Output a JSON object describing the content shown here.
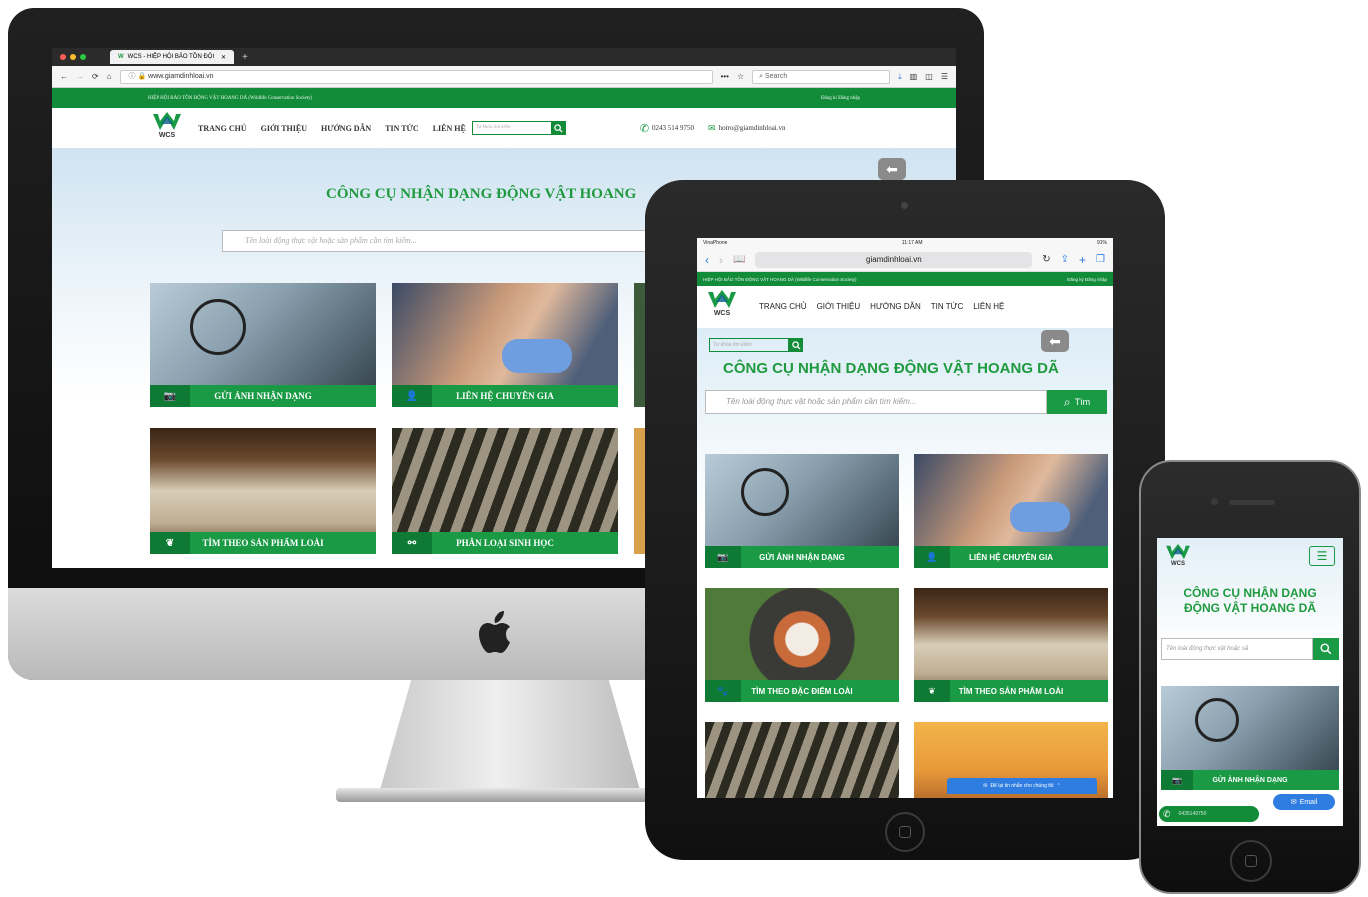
{
  "desktop": {
    "browser": {
      "tab_title": "WCS - HIỆP HỘI BẢO TỒN ĐỘI",
      "url": "www.giamdinhloai.vn",
      "search_placeholder": "Search"
    },
    "topbar": {
      "left": "HIỆP HỘI BẢO TỒN ĐỘNG VẬT HOANG DÃ (Wildlife Conservation Society)",
      "right": "Đăng kí  Đăng nhập"
    },
    "logo_text": "WCS",
    "nav": [
      "TRANG CHỦ",
      "GIỚI THIỆU",
      "HƯỚNG DẪN",
      "TIN TỨC",
      "LIÊN HỆ"
    ],
    "nav_search_placeholder": "Từ khóa tìm kiếm",
    "phone": "0243 514 9750",
    "email": "hotro@giamdinhloai.vn",
    "hero_title": "CÔNG CỤ NHẬN DẠNG ĐỘNG VẬT HOANG",
    "search_placeholder": "Tên loài động thực vật hoặc sản phẩm cần tìm kiếm...",
    "tiles": [
      "GỬI ẢNH NHẬN DẠNG",
      "LIÊN HỆ CHUYÊN GIA",
      "TÌM THEO SẢN PHẨM LOÀI",
      "PHÂN LOẠI SINH HỌC"
    ]
  },
  "tablet": {
    "status": {
      "carrier": "VinaPhone",
      "time": "11:17 AM",
      "battery": "91%"
    },
    "url": "giamdinhloai.vn",
    "topbar": {
      "left": "HIỆP HỘI BẢO TỒN ĐỘNG VẬT HOANG DÃ (Wildlife Conservation Society)",
      "right": "Đăng ký  Đăng nhập"
    },
    "logo_text": "WCS",
    "nav": [
      "TRANG CHỦ",
      "GIỚI THIỆU",
      "HƯỚNG DẪN",
      "TIN TỨC",
      "LIÊN HỆ"
    ],
    "nav_search_placeholder": "Từ khóa tìm kiếm",
    "hero_title": "CÔNG CỤ NHẬN DẠNG ĐỘNG VẬT HOANG DÃ",
    "search_placeholder": "Tên loài động thực vật hoặc sản phẩm cần tìm kiếm...",
    "search_button": "Tìm",
    "tiles": [
      "GỬI ẢNH NHẬN DẠNG",
      "LIÊN HỆ CHUYÊN GIA",
      "TÌM THEO ĐẶC ĐIỂM LOÀI",
      "TÌM THEO SẢN PHẨM LOÀI"
    ],
    "chat_text": "Để lại tin nhắn cho chúng tôi"
  },
  "phone": {
    "logo_text": "WCS",
    "hero_title_line1": "CÔNG CỤ NHẬN DẠNG",
    "hero_title_line2": "ĐỘNG VẬT HOANG DÃ",
    "search_placeholder": "Tên loài động thực vật hoặc sả",
    "tile": "GỬI ẢNH NHẬN DẠNG",
    "email_button": "Email",
    "phone_number": "0435149750"
  },
  "colors": {
    "brand_green": "#138c3a",
    "tile_green": "#1a9a45",
    "title_green": "#1f9a3f"
  }
}
